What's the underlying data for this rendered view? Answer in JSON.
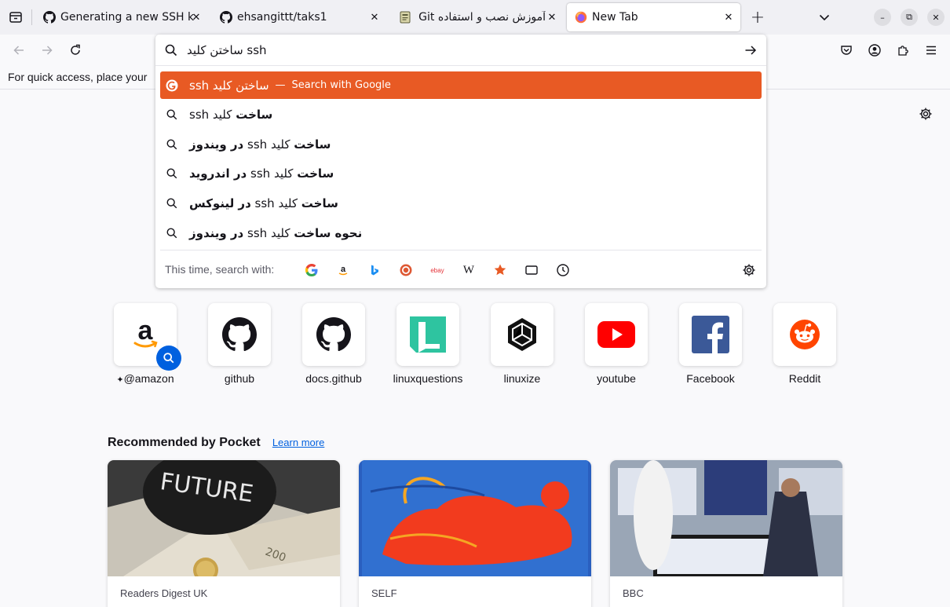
{
  "colors": {
    "accent_selected": "#e85a24",
    "link": "#0060df",
    "tab_strip": "#f0f0f4",
    "page_bg": "#f9f9fb"
  },
  "tabs": [
    {
      "title": "Generating a new SSH key",
      "icon": "github-icon",
      "active": false
    },
    {
      "title": "ehsangittt/taks1",
      "icon": "github-icon",
      "active": false
    },
    {
      "title": "آموزش نصب و استفاده Git",
      "icon": "document-icon",
      "active": false
    },
    {
      "title": "New Tab",
      "icon": "firefox-icon",
      "active": true
    }
  ],
  "bookmarks_toolbar": {
    "text": "For quick access, place your"
  },
  "urlbar": {
    "value": "ساختن کلید ssh",
    "results": [
      {
        "prefix": "ساختن کلید ssh",
        "separator": "—",
        "action": "Search with Google"
      },
      {
        "bold": "ساخت",
        "plain": "کلید ssh",
        "tail": ""
      },
      {
        "bold": "ساخت",
        "plain": "کلید ssh",
        "tail": "در ویندوز"
      },
      {
        "bold": "ساخت",
        "plain": "کلید ssh",
        "tail": "در اندروید"
      },
      {
        "bold": "ساخت",
        "plain": "کلید ssh",
        "tail": "در لینوکس"
      },
      {
        "bold": "نحوه ساخت",
        "plain": "کلید ssh",
        "tail": "در ویندوز"
      }
    ],
    "oneoff_label": "This time, search with:",
    "engines": [
      "google-icon",
      "amazon-icon",
      "bing-icon",
      "duckduckgo-icon",
      "ebay-icon",
      "wikipedia-icon",
      "bookmarks-star-icon",
      "tabs-icon",
      "history-icon"
    ],
    "ebay_text": "ebay",
    "wikipedia_text": "W"
  },
  "top_sites": [
    {
      "label": "@amazon",
      "prefix": "✦",
      "icon": "amazon-icon"
    },
    {
      "label": "github",
      "icon": "github-icon"
    },
    {
      "label": "docs.github",
      "icon": "github-icon"
    },
    {
      "label": "linuxquestions",
      "icon": "linuxquestions-icon"
    },
    {
      "label": "linuxize",
      "icon": "linuxize-icon"
    },
    {
      "label": "youtube",
      "icon": "youtube-icon"
    },
    {
      "label": "Facebook",
      "icon": "facebook-icon"
    },
    {
      "label": "Reddit",
      "icon": "reddit-icon"
    }
  ],
  "pocket": {
    "title": "Recommended by Pocket",
    "learn_more": "Learn more",
    "cards": [
      {
        "source": "Readers Digest UK",
        "image_text": "FUTURE",
        "note_text": "200"
      },
      {
        "source": "SELF"
      },
      {
        "source": "BBC"
      }
    ]
  }
}
